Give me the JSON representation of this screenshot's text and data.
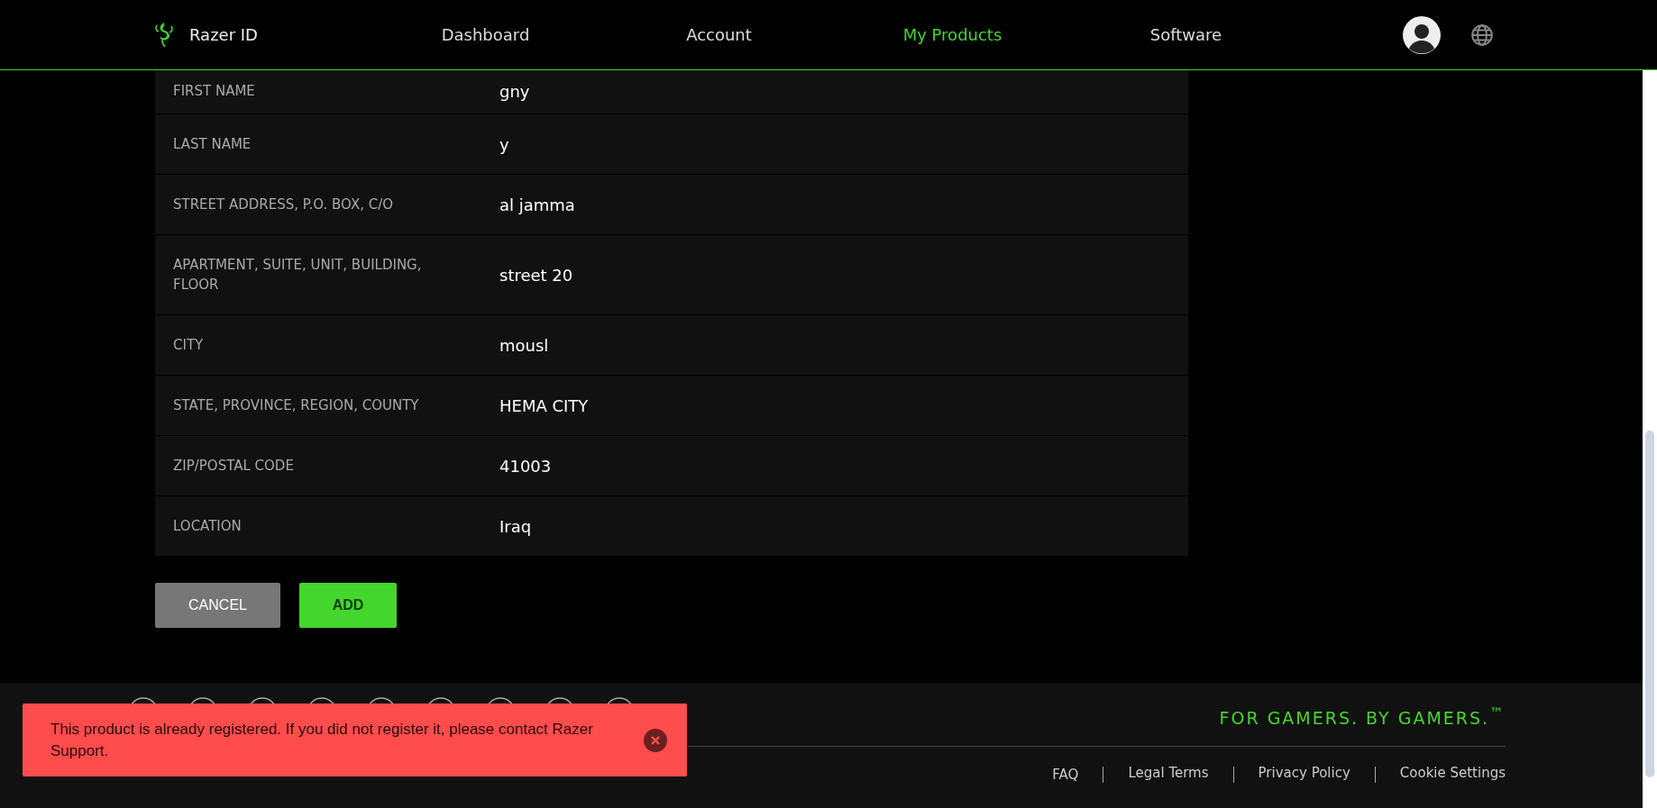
{
  "header": {
    "brand": "Razer ID",
    "nav": [
      {
        "label": "Dashboard",
        "selected": false
      },
      {
        "label": "Account",
        "selected": false
      },
      {
        "label": "My Products",
        "selected": true
      },
      {
        "label": "Software",
        "selected": false
      }
    ]
  },
  "address_table": {
    "rows": [
      {
        "label": "FIRST NAME",
        "value": "gny"
      },
      {
        "label": "LAST NAME",
        "value": "y"
      },
      {
        "label": "STREET ADDRESS, P.O. BOX, C/O",
        "value": "al jamma"
      },
      {
        "label": "APARTMENT, SUITE, UNIT, BUILDING, FLOOR",
        "value": "street 20"
      },
      {
        "label": "CITY",
        "value": "mousl"
      },
      {
        "label": "STATE, PROVINCE, REGION, COUNTY",
        "value": "HEMA CITY"
      },
      {
        "label": "ZIP/POSTAL CODE",
        "value": "41003"
      },
      {
        "label": "LOCATION",
        "value": "Iraq"
      }
    ]
  },
  "buttons": [
    {
      "label": "CANCEL",
      "kind": "secondary"
    },
    {
      "label": "ADD",
      "kind": "primary"
    }
  ],
  "footer": {
    "slogan": "FOR GAMERS. BY GAMERS.$^{™}$",
    "links": [
      "FAQ",
      "Legal Terms",
      "Privacy Policy",
      "Cookie Settings"
    ]
  },
  "toast": {
    "message": "This product is already registered. If you did not register it, please contact Razer Support."
  }
}
